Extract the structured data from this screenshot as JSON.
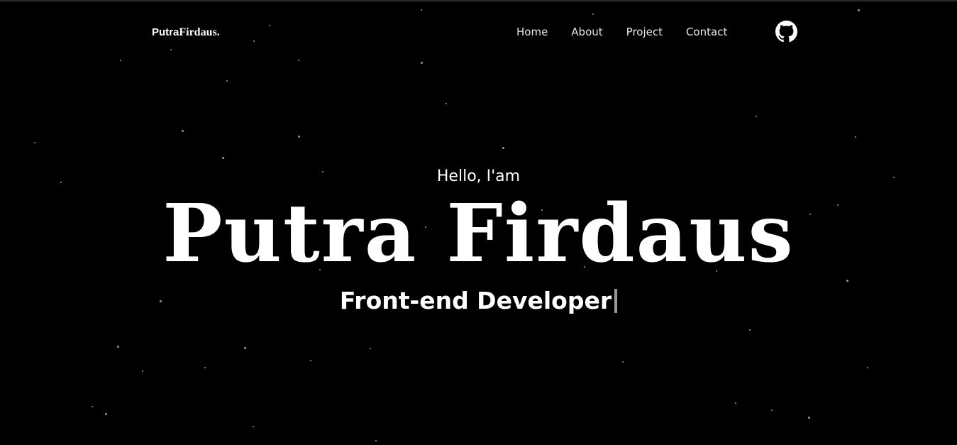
{
  "navbar": {
    "logo": {
      "part_a": "Putra",
      "part_b": "Firdaus."
    },
    "links": [
      {
        "label": "Home"
      },
      {
        "label": "About"
      },
      {
        "label": "Project"
      },
      {
        "label": "Contact"
      }
    ],
    "github_icon": "github-icon"
  },
  "hero": {
    "greeting": "Hello, I'am",
    "name": "Putra Firdaus",
    "role": "Front-end Developer"
  },
  "colors": {
    "background": "#000000",
    "text": "#ffffff",
    "star": "#9a9a9a",
    "cursor": "#9a9a9a"
  }
}
